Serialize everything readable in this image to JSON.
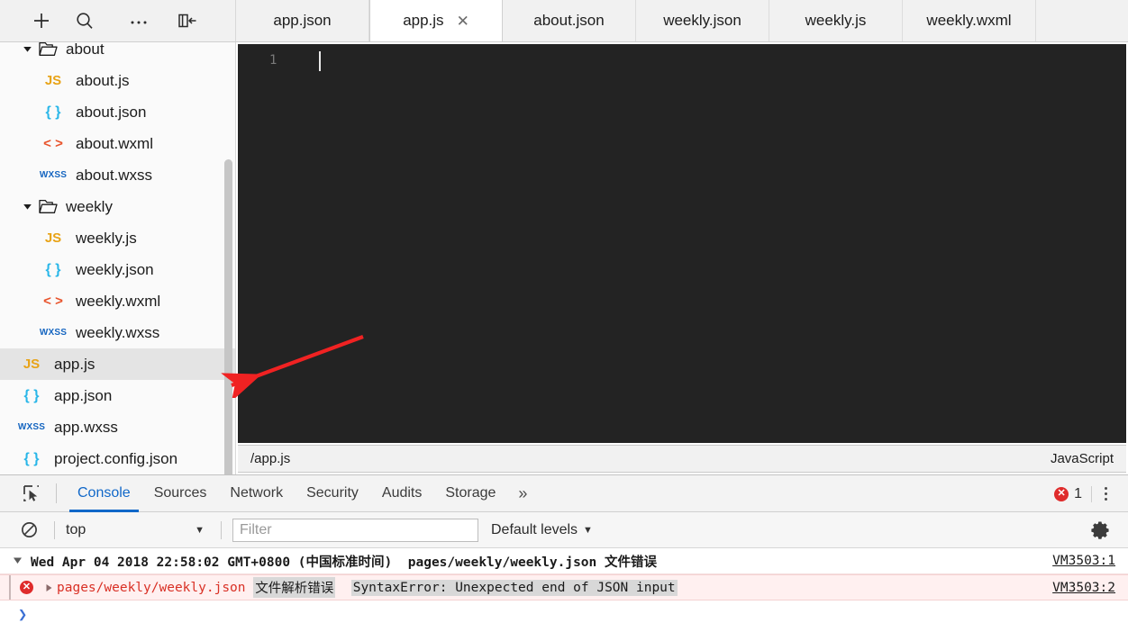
{
  "toolbar": {
    "icons": [
      {
        "name": "add-icon",
        "label": "+"
      },
      {
        "name": "search-icon",
        "label": "search"
      },
      {
        "name": "more-icon",
        "label": "···"
      },
      {
        "name": "collapse-panel-icon",
        "label": "collapse"
      }
    ]
  },
  "tabs": [
    {
      "label": "app.json",
      "active": false,
      "closable": false
    },
    {
      "label": "app.js",
      "active": true,
      "closable": true,
      "close_label": "✕"
    },
    {
      "label": "about.json",
      "active": false,
      "closable": false
    },
    {
      "label": "weekly.json",
      "active": false,
      "closable": false
    },
    {
      "label": "weekly.js",
      "active": false,
      "closable": false
    },
    {
      "label": "weekly.wxml",
      "active": false,
      "closable": false
    }
  ],
  "filetree": {
    "rows": [
      {
        "kind": "folder",
        "label": "about",
        "indent": 22,
        "expanded": true,
        "selected": false
      },
      {
        "kind": "js",
        "label": "about.js",
        "indent": 42,
        "selected": false
      },
      {
        "kind": "json",
        "label": "about.json",
        "indent": 42,
        "selected": false
      },
      {
        "kind": "wxml",
        "label": "about.wxml",
        "indent": 42,
        "selected": false
      },
      {
        "kind": "wxss",
        "label": "about.wxss",
        "indent": 42,
        "selected": false
      },
      {
        "kind": "folder",
        "label": "weekly",
        "indent": 22,
        "expanded": true,
        "selected": false
      },
      {
        "kind": "js",
        "label": "weekly.js",
        "indent": 42,
        "selected": false
      },
      {
        "kind": "json",
        "label": "weekly.json",
        "indent": 42,
        "selected": false
      },
      {
        "kind": "wxml",
        "label": "weekly.wxml",
        "indent": 42,
        "selected": false
      },
      {
        "kind": "wxss",
        "label": "weekly.wxss",
        "indent": 42,
        "selected": false
      },
      {
        "kind": "js",
        "label": "app.js",
        "indent": 18,
        "selected": true
      },
      {
        "kind": "json",
        "label": "app.json",
        "indent": 18,
        "selected": false
      },
      {
        "kind": "wxss",
        "label": "app.wxss",
        "indent": 18,
        "selected": false
      },
      {
        "kind": "json",
        "label": "project.config.json",
        "indent": 18,
        "selected": false
      }
    ],
    "type_glyphs": {
      "js": "JS",
      "json": "{ }",
      "wxml": "< >",
      "wxss": "WXSS"
    },
    "type_colors": {
      "js": "#e8a317",
      "json": "#29b6e8",
      "wxml": "#e8522a",
      "wxss": "#1565c0"
    }
  },
  "editor": {
    "line_number": "1",
    "content": "",
    "background": "#232323"
  },
  "statusbar": {
    "path": "/app.js",
    "language": "JavaScript"
  },
  "annotation": {
    "arrow_color": "#f02222",
    "points_to": "app.js"
  },
  "devtools": {
    "inspect_icon": "inspect-element-icon",
    "tabs": [
      {
        "label": "Console",
        "active": true
      },
      {
        "label": "Sources",
        "active": false
      },
      {
        "label": "Network",
        "active": false
      },
      {
        "label": "Security",
        "active": false
      },
      {
        "label": "Audits",
        "active": false
      },
      {
        "label": "Storage",
        "active": false
      }
    ],
    "overflow_label": "»",
    "error_count": "1",
    "accent_color": "#1168c9",
    "error_color": "#df2b2b",
    "filterbar": {
      "clear_icon": "clear-console-icon",
      "context": "top",
      "filter_placeholder": "Filter",
      "filter_value": "",
      "levels": "Default levels",
      "caret": "▼",
      "settings_icon": "gear-icon"
    },
    "logs": [
      {
        "type": "info",
        "expandable": true,
        "text": "Wed Apr 04 2018 22:58:02 GMT+0800 (中国标准时间)",
        "text2": "pages/weekly/weekly.json 文件错误",
        "source": "VM3503:1"
      },
      {
        "type": "error",
        "expandable": true,
        "link_text": "pages/weekly/weekly.json",
        "highlight_text": "文件解析错误",
        "rest_text": "SyntaxError: Unexpected end of JSON input",
        "source": "VM3503:2"
      }
    ],
    "prompt": "❯"
  }
}
